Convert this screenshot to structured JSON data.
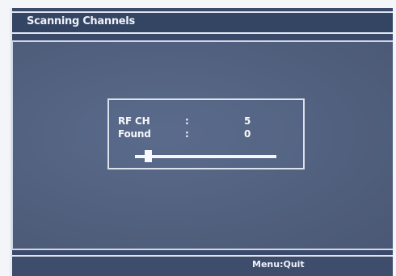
{
  "window": {
    "title": "Scanning Channels"
  },
  "scan": {
    "rows": [
      {
        "label": "RF CH",
        "separator": ":",
        "value": "5"
      },
      {
        "label": "Found",
        "separator": ":",
        "value": "0"
      }
    ],
    "progress_fraction": 0.07
  },
  "footer": {
    "hint": "Menu:Quit"
  },
  "colors": {
    "panel_background": "#52617f",
    "title_bar": "#344463",
    "text": "#f7f8fc",
    "border": "#dde2ec"
  }
}
